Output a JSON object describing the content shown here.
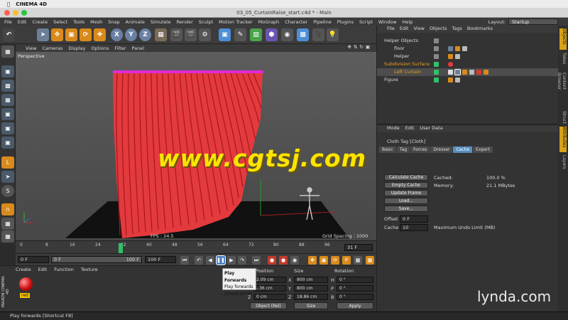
{
  "mac_menu": {
    "app_name": "CINEMA 4D"
  },
  "window": {
    "title": "03_05_CurtainRaise_start.c4d * - Main"
  },
  "menubar": {
    "items": [
      "File",
      "Edit",
      "Create",
      "Select",
      "Tools",
      "Mesh",
      "Snap",
      "Animate",
      "Simulate",
      "Render",
      "Sculpt",
      "Motion Tracker",
      "MoGraph",
      "Character",
      "Pipeline",
      "Plugins",
      "Script",
      "Window",
      "Help"
    ],
    "layout_label": "Layout:",
    "layout_value": "Startup"
  },
  "toolbar": {
    "axis_labels": [
      "X",
      "Y",
      "Z"
    ]
  },
  "viewport": {
    "menu": [
      "View",
      "Cameras",
      "Display",
      "Options",
      "Filter",
      "Panel"
    ],
    "name": "Perspective",
    "fps": "FPS : 24.5",
    "grid_spacing": "Grid Spacing : 1000 cm"
  },
  "watermark": "www.cgtsj.com",
  "timeline": {
    "ticks": [
      "0",
      "8",
      "16",
      "24",
      "32",
      "40",
      "48",
      "56",
      "64",
      "72",
      "80",
      "88",
      "96"
    ],
    "current_frame": 24,
    "end_frame": "31 F"
  },
  "transport": {
    "start_field": "0 F",
    "range_start": "0 F",
    "range_end": "100 F",
    "end_field": "100 F"
  },
  "tooltip": {
    "title": "Play Forwards",
    "line1": "Play forwards",
    "line2": "[Shortcut F8]"
  },
  "material_panel": {
    "menu": [
      "Create",
      "Edit",
      "Function",
      "Texture"
    ],
    "maxon": "MAXON CINEMA 4D",
    "material_name": "red"
  },
  "coordinates": {
    "headers": [
      "Position",
      "Size",
      "Rotation"
    ],
    "pos_values": [
      "2.09 cm",
      "-.36 cm",
      "0 cm"
    ],
    "axes": [
      "X",
      "Y",
      "Z"
    ],
    "size_values": [
      "800 cm",
      "800 cm",
      "18.86 cm"
    ],
    "rot_labels": [
      "H",
      "P",
      "B"
    ],
    "rot_values": [
      "0 °",
      "0 °",
      "0 °"
    ],
    "mode_select": "Object (Rel)",
    "size_select": "Size",
    "apply_button": "Apply"
  },
  "status": "Play forwards [Shortcut F8]",
  "object_manager": {
    "menu": [
      "File",
      "Edit",
      "View",
      "Objects",
      "Tags",
      "Bookmarks"
    ],
    "objects": [
      {
        "name": "Helper Objects",
        "indent": 0,
        "color": "#dddddd"
      },
      {
        "name": "floor",
        "indent": 1,
        "color": "#dddddd"
      },
      {
        "name": "Helper",
        "indent": 1,
        "color": "#dddddd"
      },
      {
        "name": "Subdivision Surface",
        "indent": 0,
        "color": "#f0a020"
      },
      {
        "name": "Left Curtain",
        "indent": 1,
        "color": "#f0a020"
      },
      {
        "name": "Figure",
        "indent": 0,
        "color": "#dddddd"
      }
    ]
  },
  "attributes": {
    "menu": [
      "Mode",
      "Edit",
      "User Data"
    ],
    "title": "Cloth Tag [Cloth]",
    "tabs": [
      "Basic",
      "Tag",
      "Forces",
      "Dresser",
      "Cache",
      "Expert"
    ],
    "active_tab": "Cache",
    "buttons": [
      "Calculate Cache",
      "Empty Cache",
      "Update Frame",
      "Load...",
      "Save..."
    ],
    "cached_label": "Cached:",
    "cached_value": "100.0 %",
    "memory_label": "Memory:",
    "memory_value": "21.1 MBytes",
    "offset_label": "Offset",
    "offset_value": "0 F",
    "cache_label": "Cache",
    "cache_value": "10",
    "undo_label": "Maximum Undo Limit (MB)"
  },
  "side_tabs": [
    "Objects",
    "Takes",
    "Content Browser",
    "Struct",
    "Attributes",
    "Layers"
  ],
  "brand": "lynda.com",
  "colors": {
    "accent": "#5a8fc2",
    "curtain": "#e8373b",
    "rod": "#e02ad8",
    "playhead": "#2fc268"
  }
}
